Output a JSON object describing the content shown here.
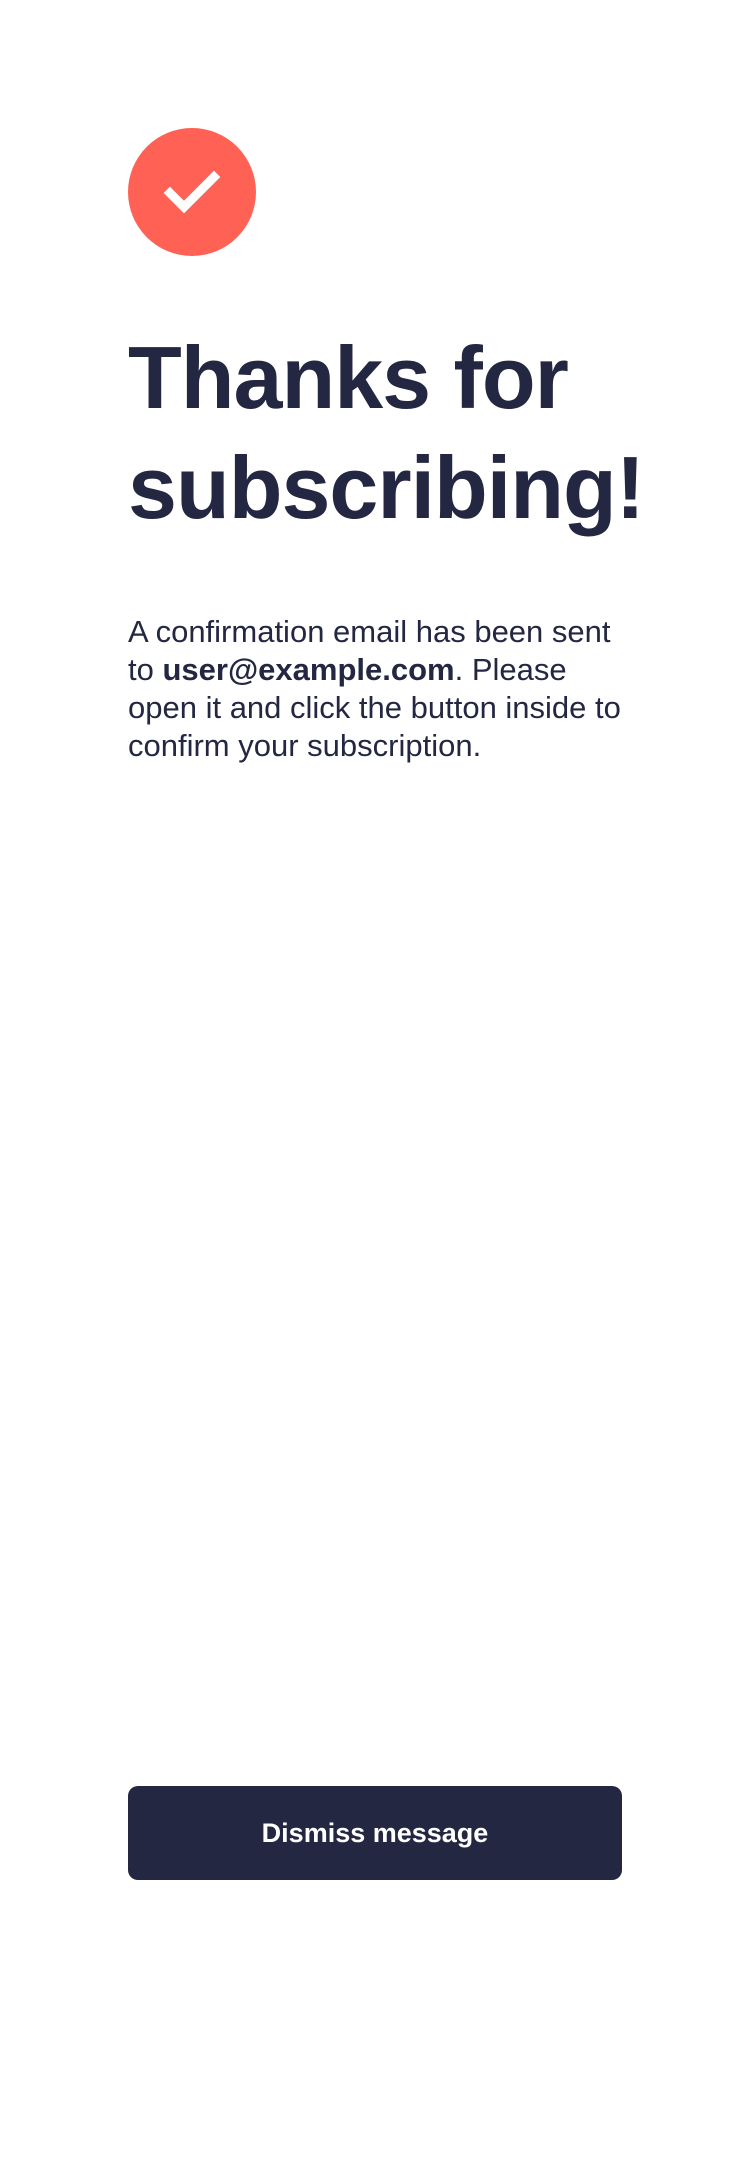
{
  "success": {
    "icon": "checkmark-icon",
    "icon_bg_color": "#ff6155",
    "title": "Thanks for subscribing!",
    "message": {
      "before_email": "A confirmation email has been sent to ",
      "email": "user@example.com",
      "after_email": ". Please open it and click the button inside to confirm your subscription."
    }
  },
  "actions": {
    "dismiss_label": "Dismiss message"
  },
  "colors": {
    "primary_dark": "#242742",
    "accent": "#ff6155",
    "background": "#ffffff"
  }
}
